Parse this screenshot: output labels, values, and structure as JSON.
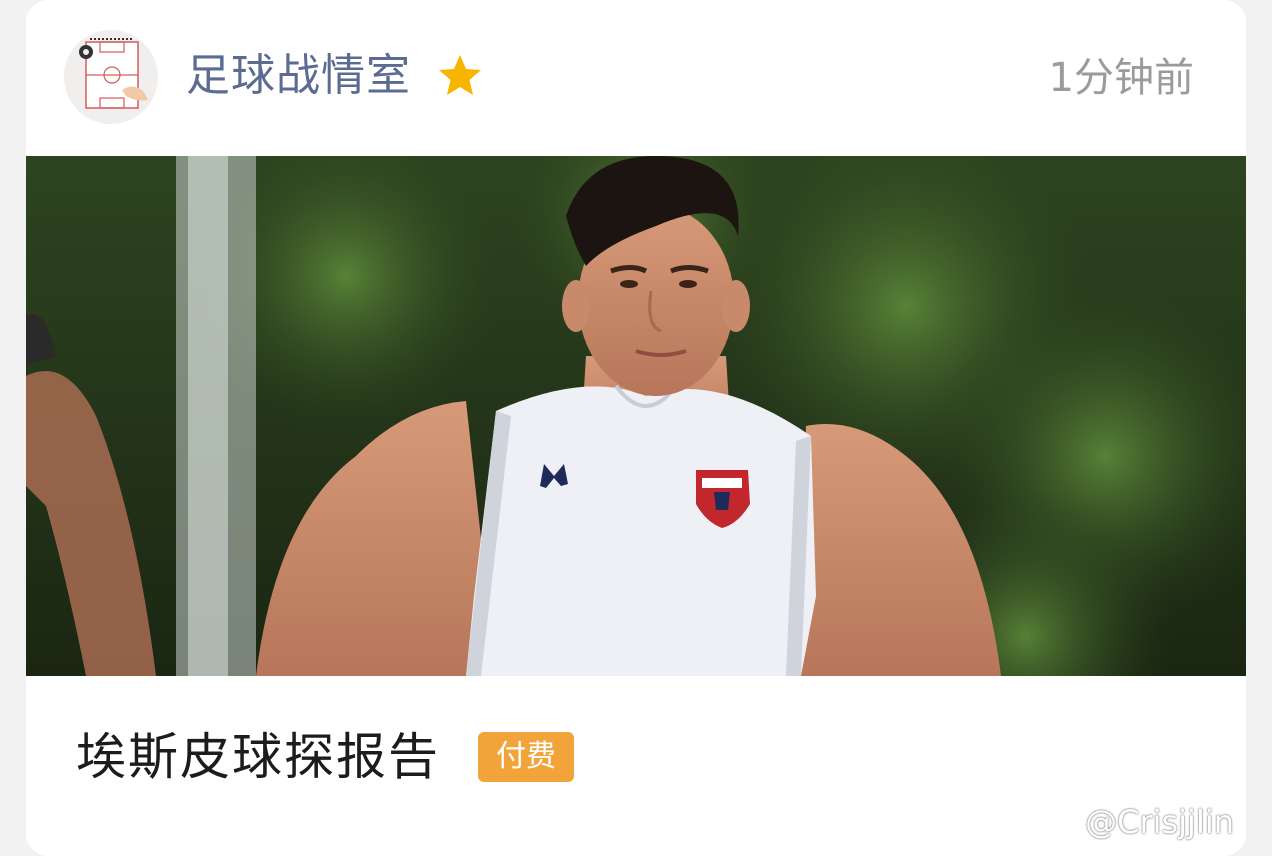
{
  "post": {
    "author_name": "足球战情室",
    "verified_icon": "star-icon",
    "timestamp": "1分钟前",
    "title": "埃斯皮球探报告",
    "badge": "付费"
  },
  "watermark": {
    "icon": "weibo-icon",
    "text": "@Crisjjlin"
  },
  "colors": {
    "author": "#5b6b91",
    "badge_bg": "#f2a33a",
    "star": "#f7b500",
    "timestamp": "#9b9b9b"
  }
}
